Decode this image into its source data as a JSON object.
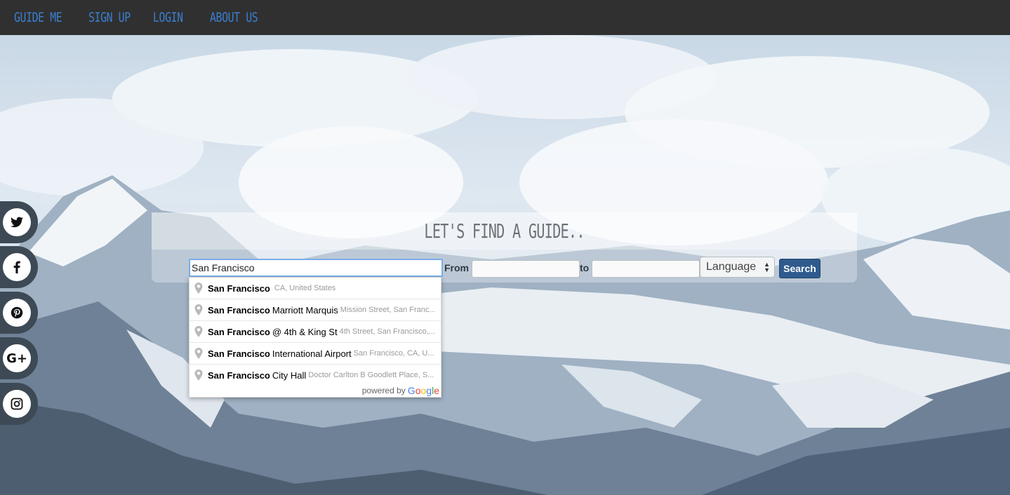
{
  "nav": {
    "items": [
      {
        "label": "GUIDE ME"
      },
      {
        "label": "SIGN UP"
      },
      {
        "label": "LOGIN"
      },
      {
        "label": "ABOUT US"
      }
    ],
    "link_color": "#3b7fd0",
    "background": "#303030"
  },
  "social": [
    {
      "icon": "twitter-icon",
      "glyph": "🐦"
    },
    {
      "icon": "facebook-icon",
      "glyph": "f"
    },
    {
      "icon": "pinterest-icon",
      "glyph": "P"
    },
    {
      "icon": "google-plus-icon",
      "glyph": "G+"
    },
    {
      "icon": "instagram-icon",
      "glyph": "◎"
    }
  ],
  "search": {
    "title": "LET'S FIND A GUIDE..",
    "location_value": "San Francisco",
    "from_label": "From",
    "to_label": "to",
    "from_value": "",
    "to_value": "",
    "language_selected": "Language",
    "search_label": "Search",
    "search_button_color": "#2e5a8e"
  },
  "autocomplete": {
    "items": [
      {
        "match": "San Francisco",
        "rest": "",
        "secondary": "CA, United States"
      },
      {
        "match": "San Francisco",
        "rest": "Marriott Marquis",
        "secondary": "Mission Street, San Franc..."
      },
      {
        "match": "San Francisco",
        "rest": "@ 4th & King St",
        "secondary": "4th Street, San Francisco,..."
      },
      {
        "match": "San Francisco",
        "rest": "International Airport",
        "secondary": "San Francisco, CA, U..."
      },
      {
        "match": "San Francisco",
        "rest": "City Hall",
        "secondary": "Doctor Carlton B Goodlett Place, S..."
      }
    ],
    "footer_text": "powered by",
    "footer_brand": "Google"
  }
}
